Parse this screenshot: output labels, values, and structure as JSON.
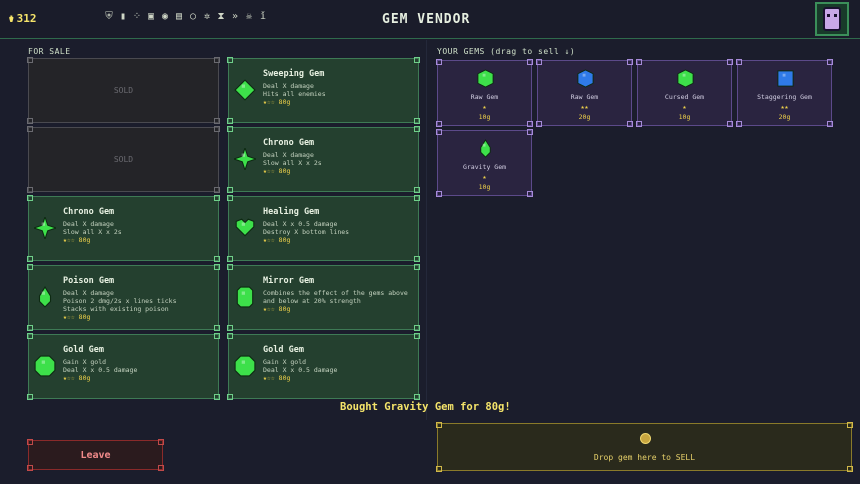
{
  "header": {
    "gold": "312",
    "title": "GEM VENDOR",
    "relics": [
      "shield-relic",
      "potion-relic",
      "dice-relic",
      "crate-relic",
      "eye-relic",
      "camera-relic",
      "ring-relic",
      "paw-relic",
      "hourglass-relic",
      "fast-forward-relic",
      "skull-relic",
      "figure-relic"
    ]
  },
  "for_sale": {
    "label": "FOR SALE",
    "cards": [
      {
        "sold": true,
        "sold_label": "SOLD"
      },
      {
        "sold": false,
        "name": "Sweeping Gem",
        "desc": "Deal X damage\nHits all enemies",
        "stars": "★☆☆",
        "price": "80g",
        "icon": "diamond-gem-icon",
        "color": "#3de04a"
      },
      {
        "sold": true,
        "sold_label": "SOLD"
      },
      {
        "sold": false,
        "name": "Chrono Gem",
        "desc": "Deal X damage\nSlow all X x 2s",
        "stars": "★☆☆",
        "price": "80g",
        "icon": "star-gem-icon",
        "color": "#3de04a"
      },
      {
        "sold": false,
        "name": "Chrono Gem",
        "desc": "Deal X damage\nSlow all X x 2s",
        "stars": "★☆☆",
        "price": "80g",
        "icon": "star-gem-icon",
        "color": "#3de04a"
      },
      {
        "sold": false,
        "name": "Healing Gem",
        "desc": "Deal X x 0.5 damage\nDestroy X bottom lines",
        "stars": "★☆☆",
        "price": "80g",
        "icon": "heart-gem-icon",
        "color": "#3de04a"
      },
      {
        "sold": false,
        "name": "Poison Gem",
        "desc": "Deal X damage\nPoison 2 dmg/2s x lines ticks\nStacks with existing poison",
        "stars": "★☆☆",
        "price": "80g",
        "icon": "drop-gem-icon",
        "color": "#3de04a"
      },
      {
        "sold": false,
        "name": "Mirror Gem",
        "desc": "Combines the effect of the gems above\nand below at 20% strength",
        "stars": "★☆☆",
        "price": "80g",
        "icon": "mirror-gem-icon",
        "color": "#3de04a"
      },
      {
        "sold": false,
        "name": "Gold Gem",
        "desc": "Gain X gold\nDeal X x 0.5 damage",
        "stars": "★☆☆",
        "price": "80g",
        "icon": "round-gem-icon",
        "color": "#3de04a"
      },
      {
        "sold": false,
        "name": "Gold Gem",
        "desc": "Gain X gold\nDeal X x 0.5 damage",
        "stars": "★☆☆",
        "price": "80g",
        "icon": "round-gem-icon",
        "color": "#3de04a"
      }
    ]
  },
  "your_gems": {
    "label": "YOUR GEMS  (drag to sell ↓)",
    "items": [
      {
        "name": "Raw Gem",
        "stars": "★",
        "price": "10g",
        "icon": "hex-gem-icon",
        "color": "#3de04a"
      },
      {
        "name": "Raw Gem",
        "stars": "★★",
        "price": "20g",
        "icon": "hex-gem-icon",
        "color": "#2f7ae8"
      },
      {
        "name": "Cursed Gem",
        "stars": "★",
        "price": "10g",
        "icon": "hex-gem-icon",
        "color": "#3de04a"
      },
      {
        "name": "Staggering Gem",
        "stars": "★★",
        "price": "20g",
        "icon": "square-gem-icon",
        "color": "#2f7ae8"
      },
      {
        "name": "Gravity Gem",
        "stars": "★",
        "price": "10g",
        "icon": "drop-gem-icon",
        "color": "#3de04a"
      }
    ]
  },
  "toast": "Bought Gravity Gem for 80g!",
  "leave_label": "Leave",
  "sell_zone_label": "Drop gem here to SELL"
}
